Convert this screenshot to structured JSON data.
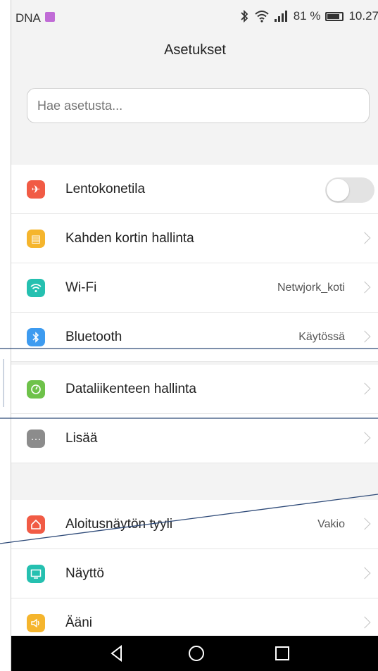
{
  "status_bar": {
    "carrier": "DNA",
    "battery_percent": "81 %",
    "time": "10.27",
    "icons": [
      "bluetooth-icon",
      "wifi-icon",
      "signal-icon",
      "battery-icon"
    ]
  },
  "header": {
    "title": "Asetukset"
  },
  "search": {
    "placeholder": "Hae asetusta..."
  },
  "settings": [
    {
      "label": "Lentokonetila",
      "icon": "airplane-icon",
      "color": "#f15b45",
      "control": "toggle",
      "toggle_on": false
    },
    {
      "label": "Kahden kortin hallinta",
      "icon": "sim-card-icon",
      "color": "#f5b52d",
      "control": "chevron"
    },
    {
      "label": "Wi-Fi",
      "value": "Netwjork_koti",
      "icon": "wifi-icon",
      "color": "#25c0b0",
      "control": "chevron"
    },
    {
      "label": "Bluetooth",
      "value": "Käytössä",
      "icon": "bluetooth-icon",
      "color": "#3d9bf0",
      "control": "chevron"
    },
    {
      "label": "Dataliikenteen hallinta",
      "icon": "data-usage-icon",
      "color": "#6ec24a",
      "control": "chevron"
    },
    {
      "label": "Lisää",
      "icon": "more-icon",
      "color": "#8c8c8c",
      "control": "chevron"
    },
    {
      "label": "Aloitusnäytön tyyli",
      "value": "Vakio",
      "icon": "home-icon",
      "color": "#f15b45",
      "control": "chevron"
    },
    {
      "label": "Näyttö",
      "icon": "display-icon",
      "color": "#25c0b0",
      "control": "chevron"
    },
    {
      "label": "Ääni",
      "icon": "sound-icon",
      "color": "#f5b52d",
      "control": "chevron"
    }
  ],
  "nav_bar": [
    "back-icon",
    "home-button-icon",
    "recents-icon"
  ]
}
